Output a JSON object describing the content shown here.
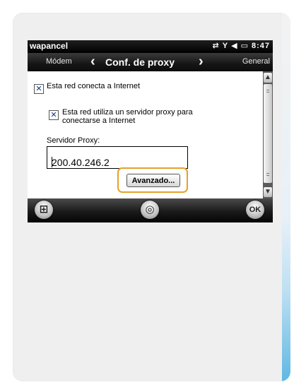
{
  "status_bar": {
    "title": "wapancel",
    "time": "8:47",
    "icons": [
      "wifi-icon",
      "signal-icon",
      "volume-icon",
      "battery-icon"
    ]
  },
  "nav": {
    "prev_label": "Módem",
    "title": "Conf. de proxy",
    "next_label": "General"
  },
  "content": {
    "internet_checkbox_label": "Esta red conecta a Internet",
    "internet_checked": true,
    "proxy_checkbox_label": "Esta red utiliza un servidor proxy para conectarse a Internet",
    "proxy_checked": true,
    "proxy_server_label": "Servidor Proxy:",
    "proxy_server_value": "200.40.246.2",
    "advanced_button_label": "Avanzado..."
  },
  "toolbar": {
    "ok_label": "OK"
  },
  "colors": {
    "highlight": "#e7a12a",
    "accent_blue": "#5fb8e3"
  }
}
